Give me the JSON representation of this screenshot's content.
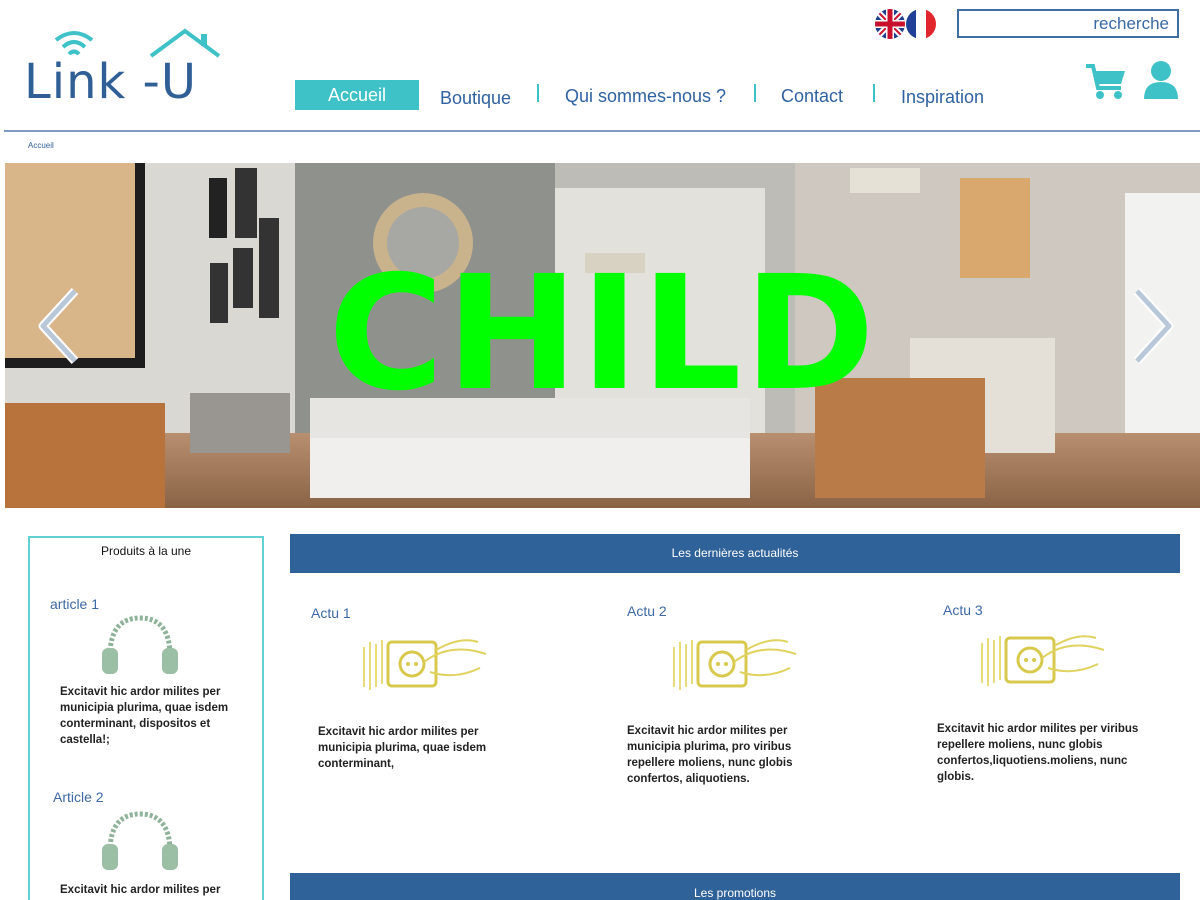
{
  "header": {
    "logo_text": "Link -U",
    "search": {
      "placeholder": "recherche"
    },
    "languages": [
      "English",
      "Français"
    ],
    "nav": {
      "home": "Accueil",
      "shop": "Boutique",
      "about": "Qui sommes-nous ?",
      "contact": "Contact",
      "inspiration": "Inspiration"
    },
    "accent_color": "#3ec2c8",
    "brand_color": "#2f5f95"
  },
  "breadcrumb": "Accueil",
  "hero": {
    "overlay_text": "CHILD"
  },
  "sidebar": {
    "title": "Produits à la une",
    "articles": [
      {
        "title": "article 1",
        "text": "Excitavit hic ardor milites per municipia plurima, quae isdem conterminant, dispositos et castella!;"
      },
      {
        "title": "Article 2",
        "text": "Excitavit hic ardor milites per"
      }
    ]
  },
  "news": {
    "title": "Les dernières actualités",
    "items": [
      {
        "title": "Actu 1",
        "text": "Excitavit hic ardor milites per municipia plurima, quae isdem conterminant,"
      },
      {
        "title": "Actu 2",
        "text": "Excitavit hic ardor milites per municipia plurima, pro viribus repellere moliens, nunc globis confertos, aliquotiens."
      },
      {
        "title": "Actu 3",
        "text": "Excitavit hic ardor milites per viribus repellere moliens, nunc globis confertos,liquotiens.moliens, nunc globis."
      }
    ]
  },
  "promotions": {
    "title": "Les promotions"
  }
}
